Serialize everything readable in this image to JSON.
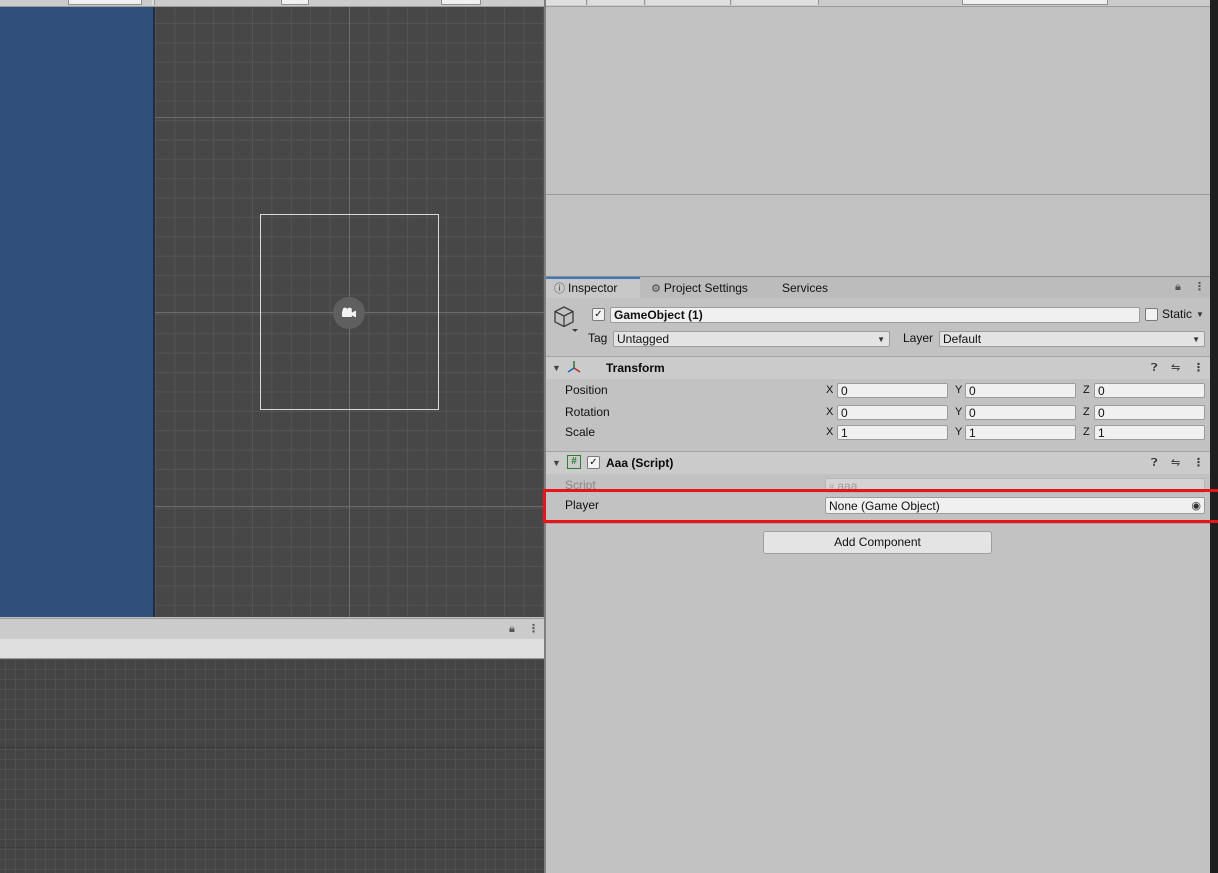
{
  "scene": {},
  "inspector": {
    "tabs": [
      {
        "label": "Inspector",
        "icon": "info-icon"
      },
      {
        "label": "Project Settings",
        "icon": "gear-icon"
      },
      {
        "label": "Services"
      }
    ],
    "gameobject": {
      "active": true,
      "name": "GameObject (1)",
      "static_label": "Static",
      "tag_label": "Tag",
      "tag_value": "Untagged",
      "layer_label": "Layer",
      "layer_value": "Default"
    },
    "transform": {
      "title": "Transform",
      "rows": [
        {
          "label": "Position",
          "x": "0",
          "y": "0",
          "z": "0"
        },
        {
          "label": "Rotation",
          "x": "0",
          "y": "0",
          "z": "0"
        },
        {
          "label": "Scale",
          "x": "1",
          "y": "1",
          "z": "1"
        }
      ],
      "axis_x": "X",
      "axis_y": "Y",
      "axis_z": "Z"
    },
    "script_component": {
      "enabled": true,
      "title": "Aaa (Script)",
      "script_label": "Script",
      "script_value": "aaa",
      "player_label": "Player",
      "player_value": "None (Game Object)"
    },
    "add_component_label": "Add Component"
  },
  "colors": {
    "highlight": "#e8141c",
    "scene_background": "#474747",
    "left_panel": "#304f7a",
    "tab_accent": "#3a79bb"
  }
}
